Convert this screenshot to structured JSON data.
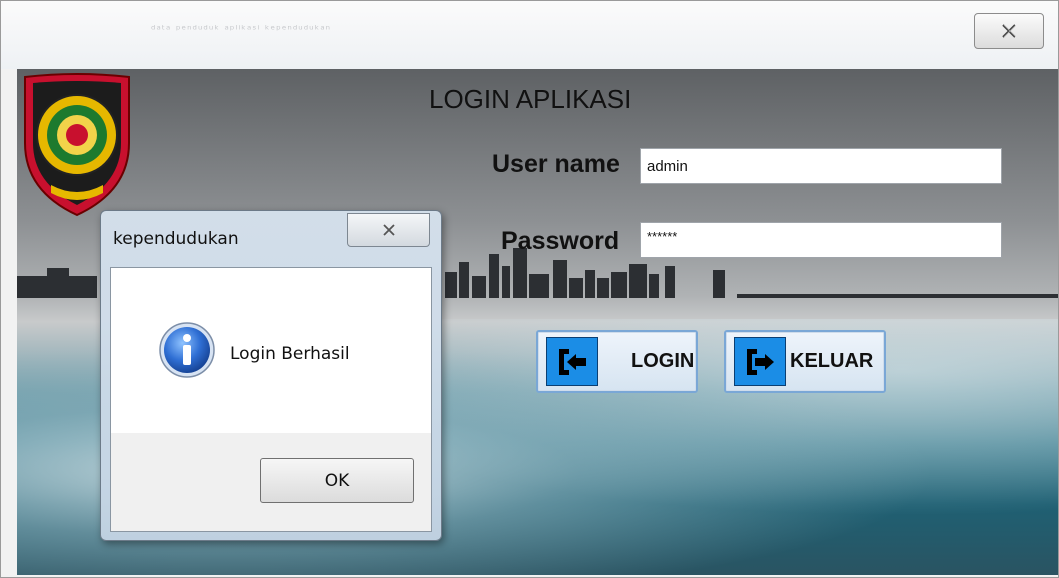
{
  "window": {
    "faded_title": "ᵈᵃᵗᵃ ᵖᵉⁿᵈᵘᵈᵘᵏ ᵃᵖˡⁱᵏᵃˢⁱ ᵏᵉᵖᵉⁿᵈᵘᵈᵘᵏᵃⁿ",
    "close_icon": "close-x-icon"
  },
  "login": {
    "title": "LOGIN APLIKASI",
    "username_label": "User name",
    "username_value": "admin",
    "password_label": "Password",
    "password_value": "******",
    "login_button": "LOGIN",
    "exit_button": "KELUAR"
  },
  "dialog": {
    "title": "kependudukan",
    "message": "Login Berhasil",
    "ok_button": "OK",
    "icon": "info-icon"
  },
  "colors": {
    "button_icon_blue": "#1b8de6",
    "emblem_red": "#c8102e",
    "emblem_gold": "#e6b800"
  }
}
